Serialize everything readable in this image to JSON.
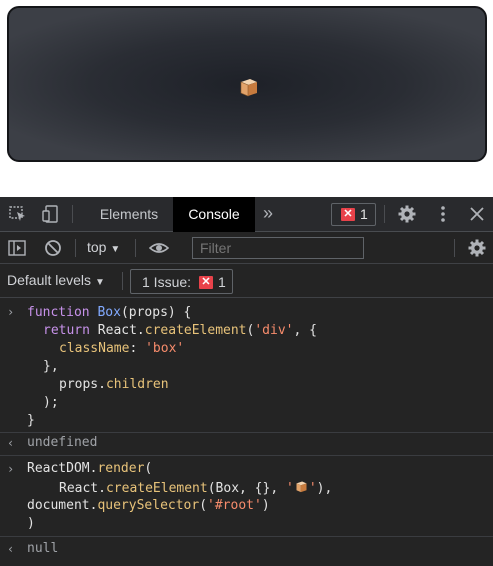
{
  "devtools": {
    "tabs": [
      {
        "label": "Elements"
      },
      {
        "label": "Console"
      }
    ],
    "more_tabs": "»",
    "error_count": "1",
    "console_toolbar": {
      "context": "top",
      "filter_placeholder": "Filter",
      "levels": "Default levels",
      "issues_label": "1 Issue:",
      "issues_count": "1"
    }
  },
  "console": {
    "entry1": {
      "line1": {
        "k": "function",
        "fn": "Box",
        "rest": "(props) {"
      },
      "line2": {
        "k": "return",
        "obj": "React.",
        "method": "createElement",
        "open": "(",
        "str": "'div'",
        "close": ", {"
      },
      "line3": {
        "prop": "className",
        "colon": ": ",
        "str": "'box'"
      },
      "line4": "},",
      "line5": {
        "obj": "props.",
        "prop": "children"
      },
      "line6": ");",
      "line7": "}",
      "result": "undefined"
    },
    "entry2": {
      "line1": {
        "obj": "ReactDOM.",
        "method": "render",
        "open": "("
      },
      "line2": {
        "obj": "React.",
        "method": "createElement",
        "args": "(Box, {}, ",
        "str_open": "'",
        "str_close": "'",
        "close": "),"
      },
      "line3": {
        "obj": "document.",
        "method": "querySelector",
        "open": "(",
        "str": "'#root'",
        "close": ")"
      },
      "line4": ")",
      "result": "null"
    }
  },
  "colors": {
    "keyword": "#c792ea",
    "function_name": "#82aaff",
    "property": "#e8c37a",
    "string": "#f78c6c",
    "error_badge": "#e8424a"
  }
}
